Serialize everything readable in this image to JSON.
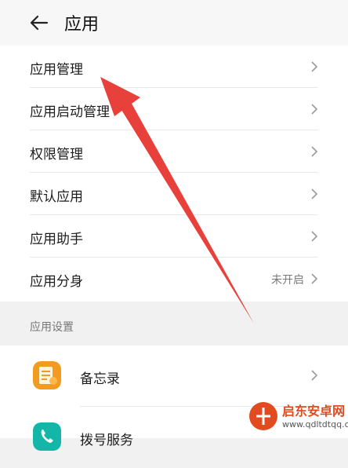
{
  "header": {
    "back_icon": "arrow-left-icon",
    "title": "应用"
  },
  "menu": {
    "items": [
      {
        "label": "应用管理",
        "icon": "chevron-right-icon"
      },
      {
        "label": "应用启动管理",
        "icon": "chevron-right-icon"
      },
      {
        "label": "权限管理",
        "icon": "chevron-right-icon"
      },
      {
        "label": "默认应用",
        "icon": "chevron-right-icon"
      },
      {
        "label": "应用助手",
        "icon": "chevron-right-icon"
      },
      {
        "label": "应用分身",
        "value": "未开启",
        "icon": "chevron-right-icon"
      }
    ]
  },
  "app_settings": {
    "section_label": "应用设置",
    "items": [
      {
        "label": "备忘录",
        "icon": "memo-app-icon",
        "color": "#f39a21"
      },
      {
        "label": "拨号服务",
        "icon": "dialer-app-icon",
        "color": "#14b6a8"
      }
    ]
  },
  "annotation": {
    "arrow_color": "#e8403a"
  },
  "watermark": {
    "title": "启东安卓网",
    "url": "www.qdltdtqq.com",
    "color": "#e14b1f"
  }
}
